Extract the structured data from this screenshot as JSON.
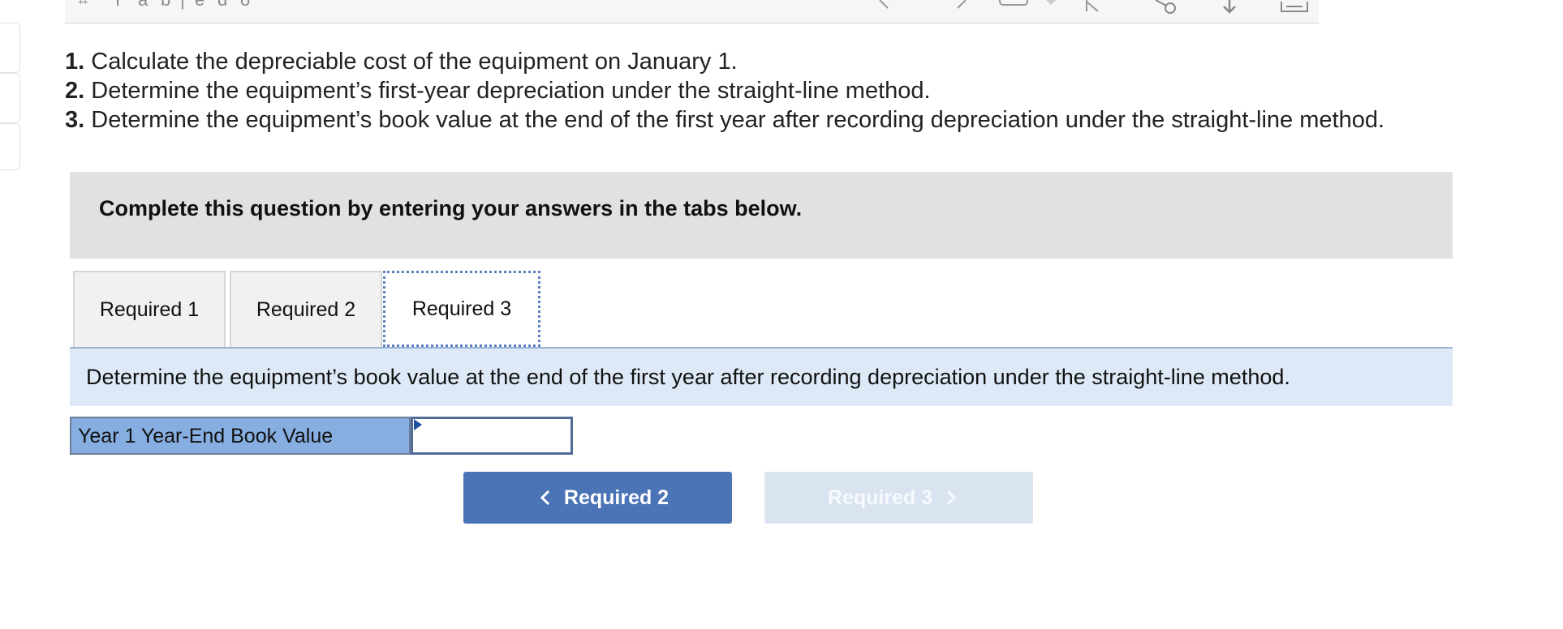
{
  "toolbar": {
    "icons": [
      "grid-icon",
      "bold-icon",
      "italic-icon",
      "underline-icon",
      "text-color-icon",
      "undo-icon",
      "redo-icon",
      "comment-icon",
      "dropdown-icon",
      "cursor-icon",
      "link-icon",
      "download-icon",
      "expand-icon"
    ]
  },
  "questions": [
    {
      "num": "1.",
      "text": "Calculate the depreciable cost of the equipment on January 1."
    },
    {
      "num": "2.",
      "text": "Determine the equipment’s first-year depreciation under the straight-line method."
    },
    {
      "num": "3.",
      "text": "Determine the equipment’s book value at the end of the first year after recording depreciation under the straight-line method."
    }
  ],
  "instructions": "Complete this question by entering your answers in the tabs below.",
  "tabs": [
    {
      "label": "Required 1",
      "active": false
    },
    {
      "label": "Required 2",
      "active": false
    },
    {
      "label": "Required 3",
      "active": true
    }
  ],
  "requirement_text": "Determine the equipment’s book value at the end of the first year after recording depreciation under the straight-line method.",
  "answer": {
    "label": "Year 1 Year-End Book Value",
    "value": ""
  },
  "nav": {
    "prev_label": "Required 2",
    "next_label": "Required 3",
    "next_enabled": false
  },
  "colors": {
    "accent": "#4a74b6",
    "tab_focus": "#5a7fc0",
    "label_fill": "#86aee0",
    "panel_blue": "#dde9f6"
  }
}
